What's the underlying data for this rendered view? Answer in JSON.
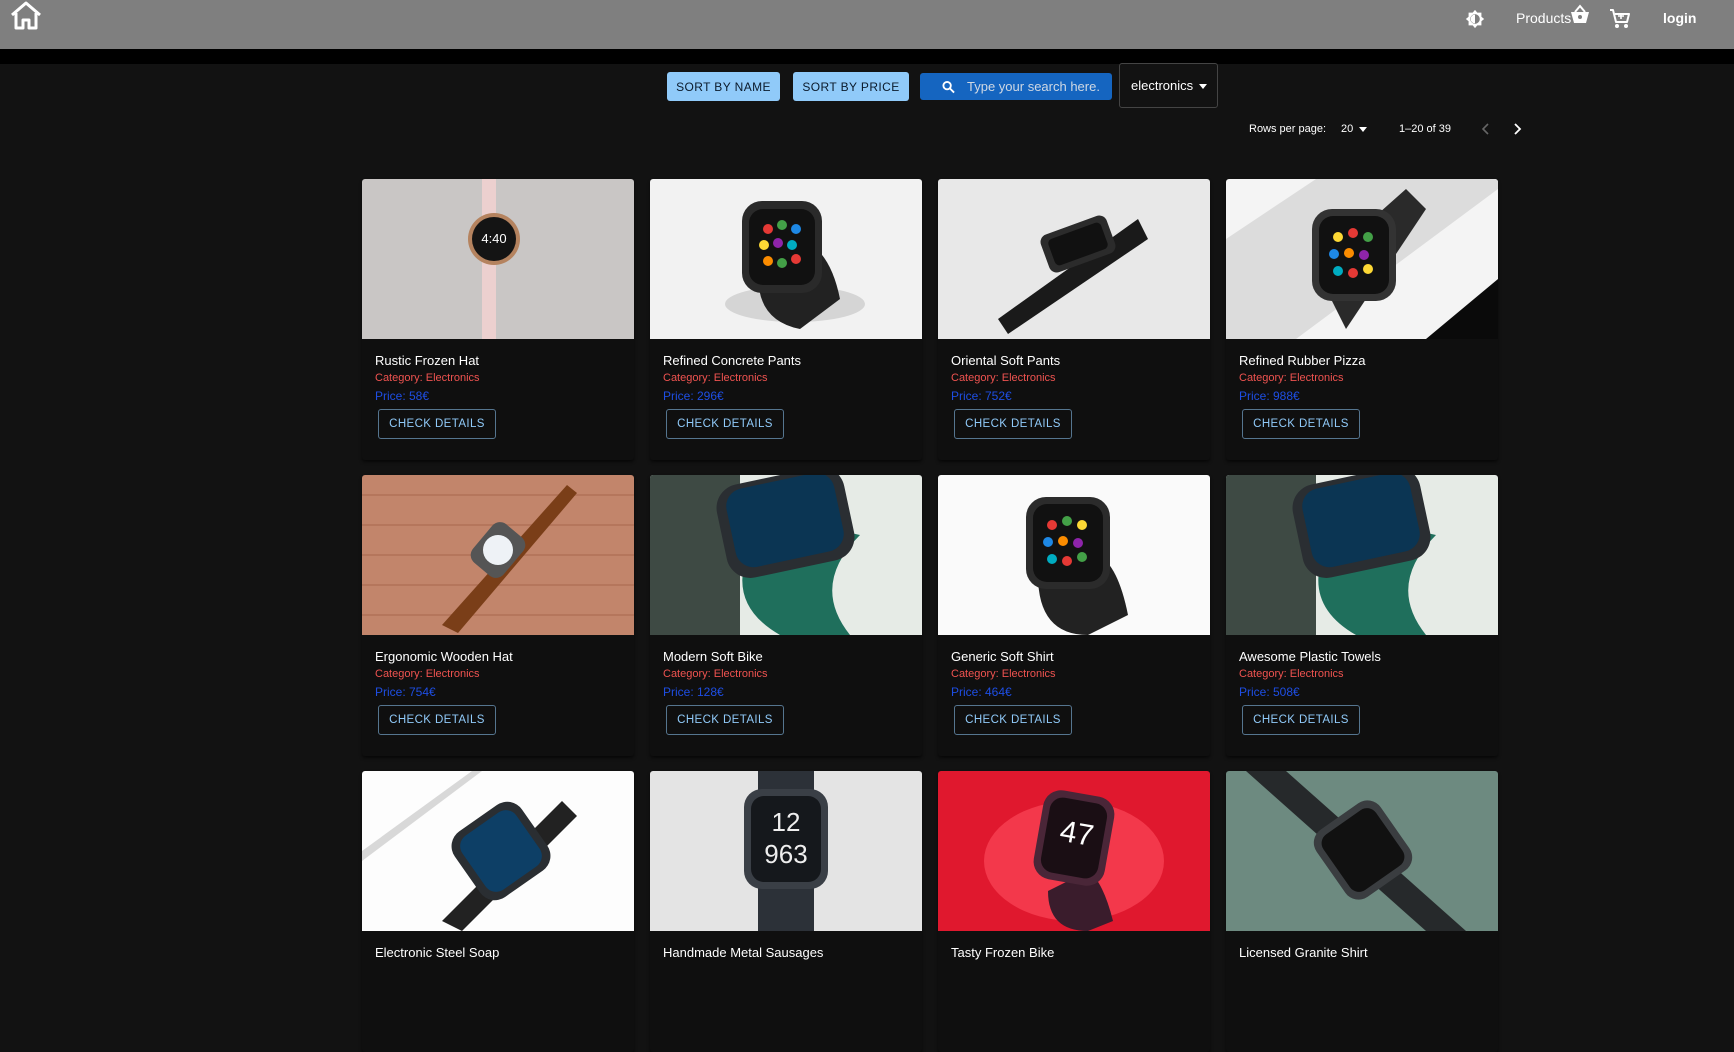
{
  "nav": {
    "home_icon": "home-icon",
    "theme_icon": "brightness-icon",
    "products_label": "Products",
    "basket_icon": "shopping-basket-icon",
    "cart_icon": "cart-icon",
    "login_label": "login"
  },
  "toolbar": {
    "sort_name_label": "SORT BY NAME",
    "sort_price_label": "SORT BY PRICE",
    "search_placeholder": "Type your search here.",
    "category_selected": "electronics"
  },
  "pagination": {
    "rows_per_page_label": "Rows per page:",
    "rows_per_page": "20",
    "range_text": "1–20 of 39"
  },
  "products": [
    {
      "name": "Rustic Frozen Hat",
      "category": "Category: Electronics",
      "price": "Price: 58€",
      "button": "CHECK DETAILS"
    },
    {
      "name": "Refined Concrete Pants",
      "category": "Category: Electronics",
      "price": "Price: 296€",
      "button": "CHECK DETAILS"
    },
    {
      "name": "Oriental Soft Pants",
      "category": "Category: Electronics",
      "price": "Price: 752€",
      "button": "CHECK DETAILS"
    },
    {
      "name": "Refined Rubber Pizza",
      "category": "Category: Electronics",
      "price": "Price: 988€",
      "button": "CHECK DETAILS"
    },
    {
      "name": "Ergonomic Wooden Hat",
      "category": "Category: Electronics",
      "price": "Price: 754€",
      "button": "CHECK DETAILS"
    },
    {
      "name": "Modern Soft Bike",
      "category": "Category: Electronics",
      "price": "Price: 128€",
      "button": "CHECK DETAILS"
    },
    {
      "name": "Generic Soft Shirt",
      "category": "Category: Electronics",
      "price": "Price: 464€",
      "button": "CHECK DETAILS"
    },
    {
      "name": "Awesome Plastic Towels",
      "category": "Category: Electronics",
      "price": "Price: 508€",
      "button": "CHECK DETAILS"
    },
    {
      "name": "Electronic Steel Soap",
      "category": "",
      "price": "",
      "button": ""
    },
    {
      "name": "Handmade Metal Sausages",
      "category": "",
      "price": "",
      "button": ""
    },
    {
      "name": "Tasty Frozen Bike",
      "category": "",
      "price": "",
      "button": ""
    },
    {
      "name": "Licensed Granite Shirt",
      "category": "",
      "price": "",
      "button": ""
    }
  ],
  "colors": {
    "appbar": "#7f7f7f",
    "background": "#121212",
    "card": "#0f0f0f",
    "sort_button": "#90caf9",
    "search": "#1565c0",
    "category_text": "#ef5350",
    "price_text": "#1e4ee3"
  }
}
